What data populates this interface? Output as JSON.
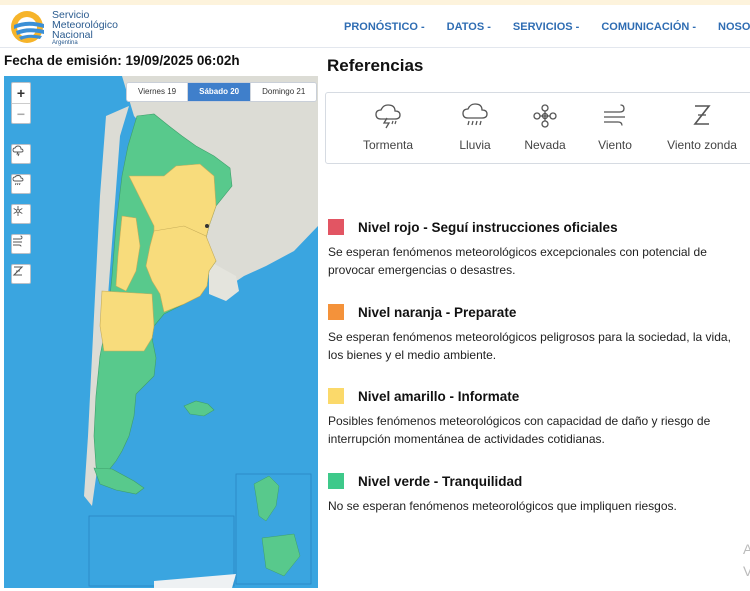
{
  "header": {
    "logo_lines": [
      "Servicio",
      "Meteorológico",
      "Nacional",
      "Argentina"
    ],
    "nav": [
      "PRONÓSTICO -",
      "DATOS -",
      "SERVICIOS -",
      "COMUNICACIÓN -",
      "NOSOTROS"
    ]
  },
  "emission": "Fecha de emisión: 19/09/2025 06:02h",
  "map": {
    "days": [
      {
        "label": "Viernes 19",
        "active": false
      },
      {
        "label": "Sábado 20",
        "active": true
      },
      {
        "label": "Domingo 21",
        "active": false
      }
    ],
    "zoom_in": "+",
    "zoom_out": "−",
    "layer_buttons": [
      "storm-icon",
      "rain-icon",
      "snow-icon",
      "wind-icon",
      "zonda-icon"
    ],
    "colors": {
      "ocean": "#3aa5e0",
      "land": "#dcdcd5",
      "green": "#58c98c",
      "yellow": "#f8dc7c"
    }
  },
  "references": {
    "title": "Referencias",
    "items": [
      {
        "icon": "storm-icon",
        "label": "Tormenta"
      },
      {
        "icon": "rain-icon",
        "label": "Lluvia"
      },
      {
        "icon": "snow-icon",
        "label": "Nevada"
      },
      {
        "icon": "wind-icon",
        "label": "Viento"
      },
      {
        "icon": "zonda-icon",
        "label": "Viento zonda"
      }
    ]
  },
  "levels": [
    {
      "color": "#e25563",
      "name": "Nivel rojo - Seguí instrucciones oficiales",
      "desc": "Se esperan fenómenos meteorológicos excepcionales con potencial de provocar emergencias o desastres."
    },
    {
      "color": "#f4923a",
      "name": "Nivel naranja - Preparate",
      "desc": "Se esperan fenómenos meteorológicos peligrosos para la sociedad, la vida, los bienes y el medio ambiente."
    },
    {
      "color": "#fbd96a",
      "name": "Nivel amarillo - Informate",
      "desc": "Posibles fenómenos meteorológicos con capacidad de daño y riesgo de interrupción momentánea de actividades cotidianas."
    },
    {
      "color": "#3ec98a",
      "name": "Nivel verde - Tranquilidad",
      "desc": "No se esperan fenómenos meteorológicos que impliquen riesgos."
    }
  ],
  "corner_text": [
    "A",
    "V"
  ]
}
